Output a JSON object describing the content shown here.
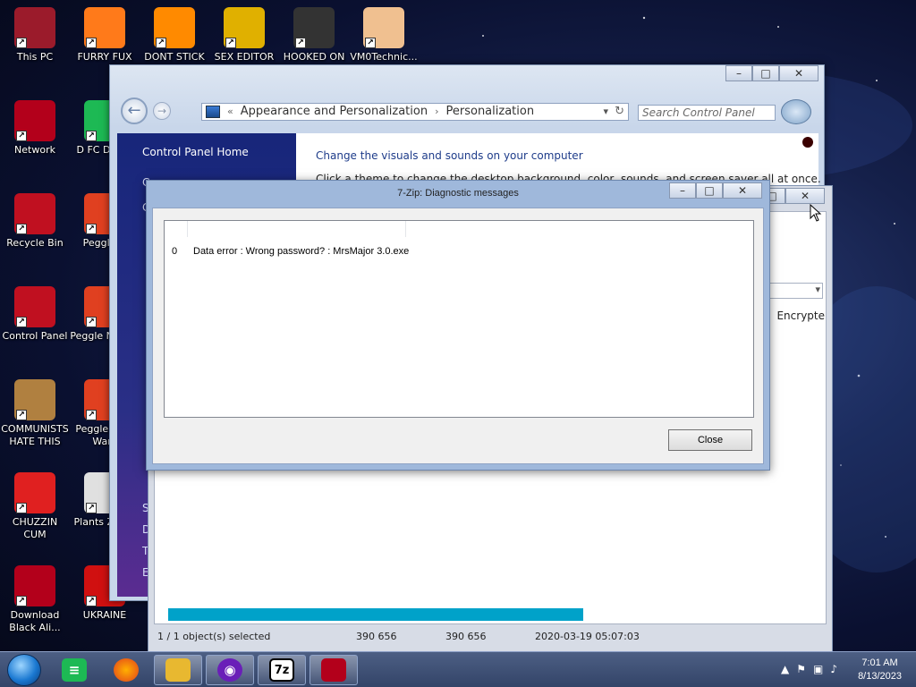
{
  "desktop_icons": [
    {
      "label": "This PC",
      "icon": "this-pc-icon",
      "color": "#9b1b2b"
    },
    {
      "label": "FURRY FUX",
      "icon": "firefox-icon",
      "color": "#ff7a1a"
    },
    {
      "label": "DONT STICK",
      "icon": "vlc-icon",
      "color": "#ff8a00"
    },
    {
      "label": "SEX EDITOR",
      "icon": "hxd-icon",
      "color": "#e0b000"
    },
    {
      "label": "HOOKED ON",
      "icon": "game-icon",
      "color": "#333333"
    },
    {
      "label": "VM0Technic...",
      "icon": "doctor-icon",
      "color": "#f0c090"
    },
    {
      "label": "Network",
      "icon": "network-icon",
      "color": "#b3001b"
    },
    {
      "label": "D FC DUMB",
      "icon": "spotify-icon",
      "color": "#1db954"
    },
    {
      "label": "Recycle Bin",
      "icon": "recycle-bin-icon",
      "color": "#c01020"
    },
    {
      "label": "Peggle D",
      "icon": "peggle-icon",
      "color": "#e04020"
    },
    {
      "label": "Control Panel",
      "icon": "control-panel-icon",
      "color": "#c01020"
    },
    {
      "label": "Peggle N Delu",
      "icon": "peggle-icon",
      "color": "#e04020"
    },
    {
      "label": "COMMUNISTS HATE THIS G...",
      "icon": "money-bag-icon",
      "color": "#b08040"
    },
    {
      "label": "Peggle W of Warc",
      "icon": "peggle-icon",
      "color": "#e04020"
    },
    {
      "label": "CHUZZIN CUM",
      "icon": "chuzzle-icon",
      "color": "#e02020"
    },
    {
      "label": "Plants Zomb",
      "icon": "plants-icon",
      "color": "#e0e0e0"
    },
    {
      "label": "Download Black Ali...",
      "icon": "alien-icon",
      "color": "#b3001b"
    },
    {
      "label": "UKRAINE",
      "icon": "hazard-icon",
      "color": "#d01010"
    }
  ],
  "control_panel": {
    "breadcrumb": [
      "Appearance and Personalization",
      "Personalization"
    ],
    "search_placeholder": "Search Control Panel",
    "sidebar_home": "Control Panel Home",
    "heading": "Change the visuals and sounds on your computer",
    "subheading": "Click a theme to change the desktop background, color, sounds, and screen saver all at once.",
    "sidebar_fragments": [
      "C",
      "C",
      "S",
      "D",
      "T",
      "E"
    ]
  },
  "zip_window": {
    "column_encrypted": "Encrypte",
    "progress": 0.62,
    "status": {
      "selection": "1 / 1 object(s) selected",
      "size": "390 656",
      "packed": "390 656",
      "modified": "2020-03-19 05:07:03"
    }
  },
  "dialog": {
    "title": "7-Zip: Diagnostic messages",
    "messages": [
      {
        "index": "0",
        "text": "Data error : Wrong password? : MrsMajor 3.0.exe"
      }
    ],
    "close_label": "Close"
  },
  "taskbar": {
    "pinned": [
      "spotify-icon",
      "firefox-icon",
      "file-explorer-icon",
      "mask-icon",
      "7zip-icon",
      "control-panel-icon"
    ],
    "clock_time": "7:01 AM",
    "clock_date": "8/13/2023"
  }
}
